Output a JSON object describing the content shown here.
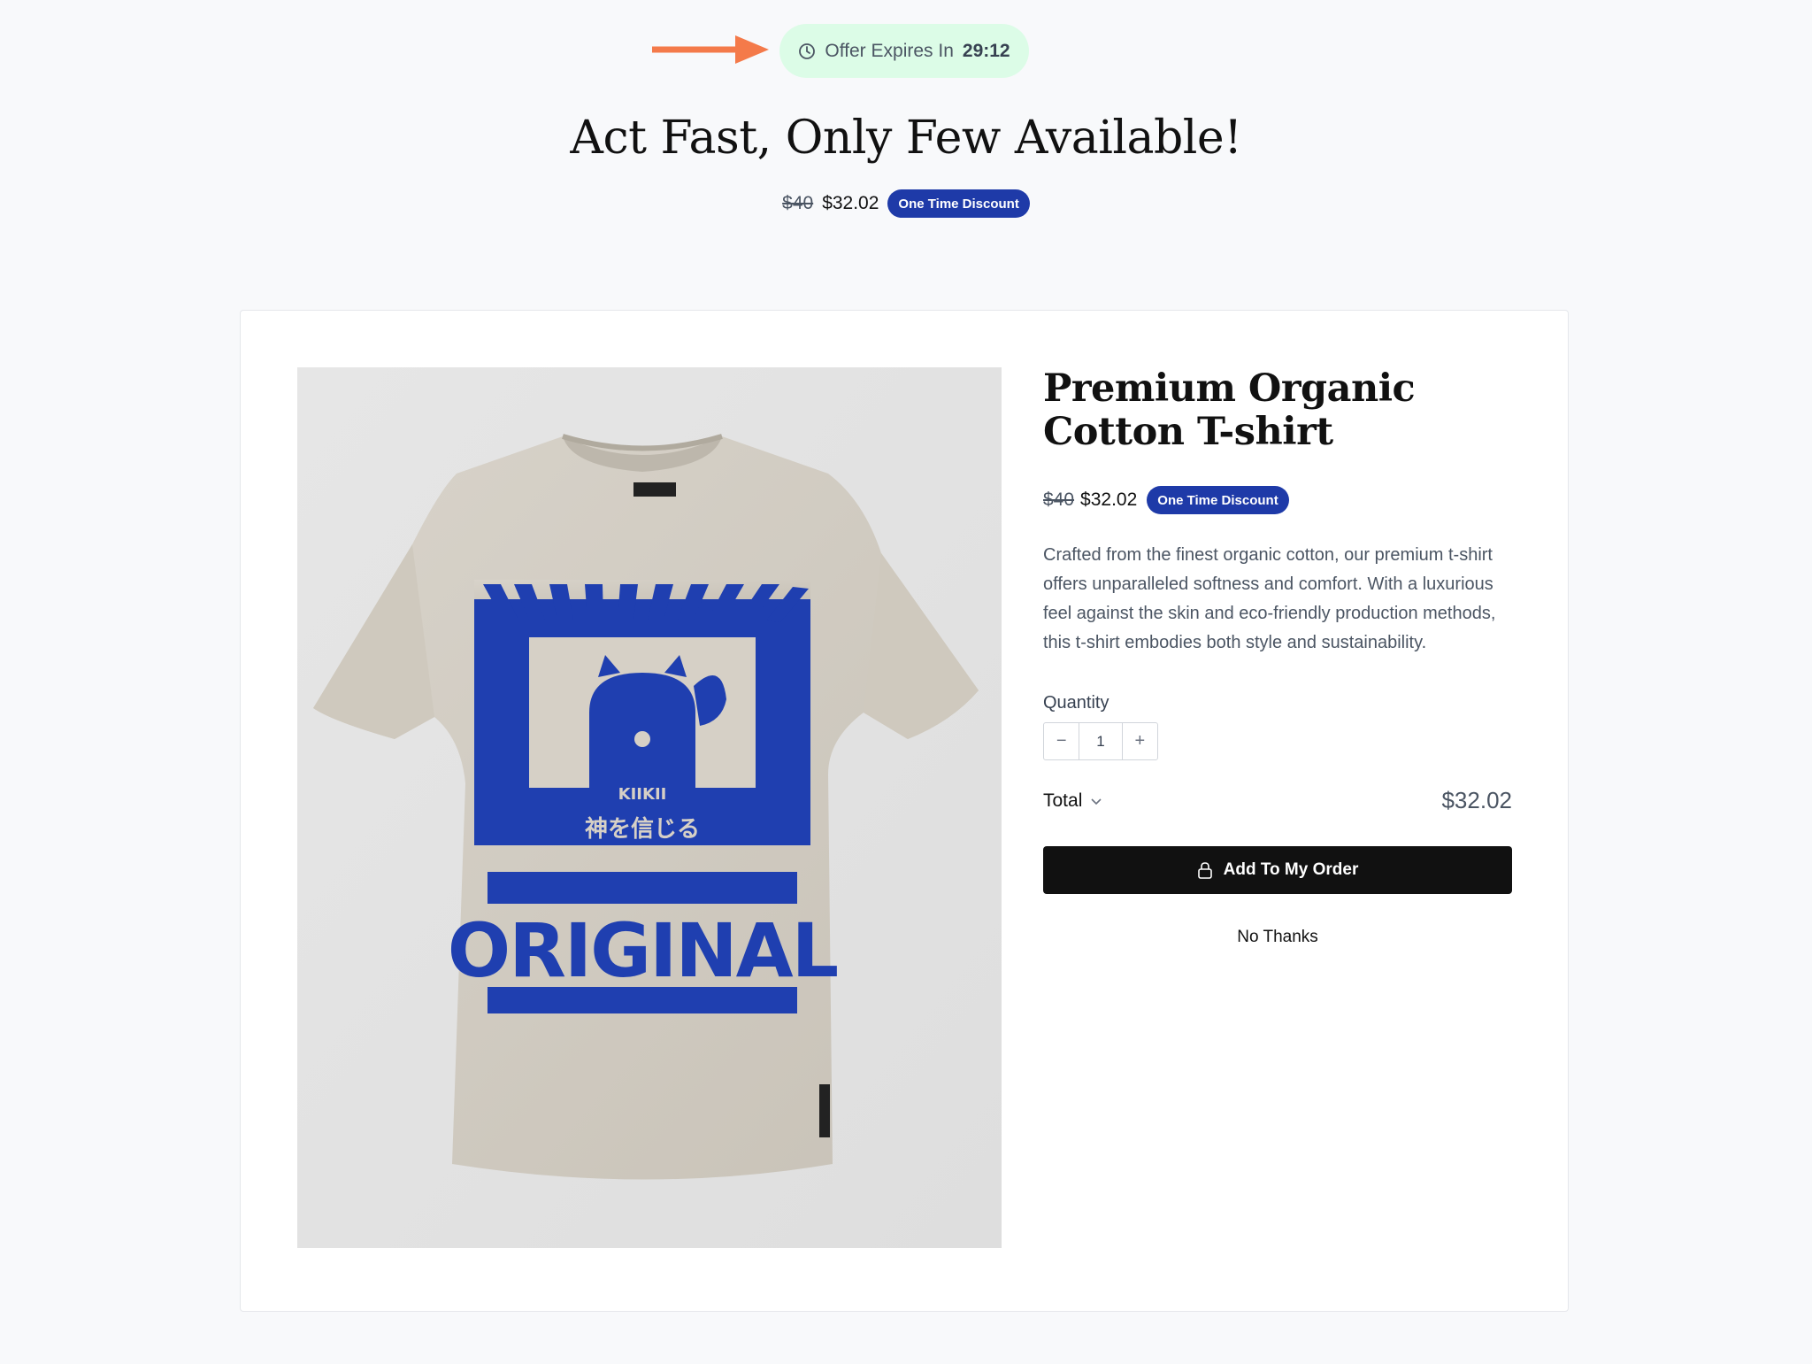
{
  "timer": {
    "label": "Offer Expires In",
    "time": "29:12"
  },
  "headline": "Act Fast, Only Few Available!",
  "pricing": {
    "original": "$40",
    "discounted": "$32.02",
    "badge": "One Time Discount"
  },
  "product": {
    "title": "Premium Organic Cotton T-shirt",
    "description": "Crafted from the finest organic cotton, our premium t-shirt offers unparalleled softness and comfort. With a luxurious feel against the skin and eco-friendly production methods, this t-shirt embodies both style and sustainability.",
    "shirt_text": {
      "brand": "KIIKII",
      "japanese": "神を信じる",
      "word": "ORIGINAL"
    }
  },
  "quantity": {
    "label": "Quantity",
    "value": "1",
    "minus": "−",
    "plus": "+"
  },
  "total": {
    "label": "Total",
    "value": "$32.02"
  },
  "actions": {
    "add": "Add To My Order",
    "decline": "No Thanks"
  },
  "colors": {
    "accent_badge": "#1e3aa8",
    "timer_bg": "#dcfce7",
    "arrow": "#f97316",
    "shirt_print": "#1f3fb0"
  }
}
